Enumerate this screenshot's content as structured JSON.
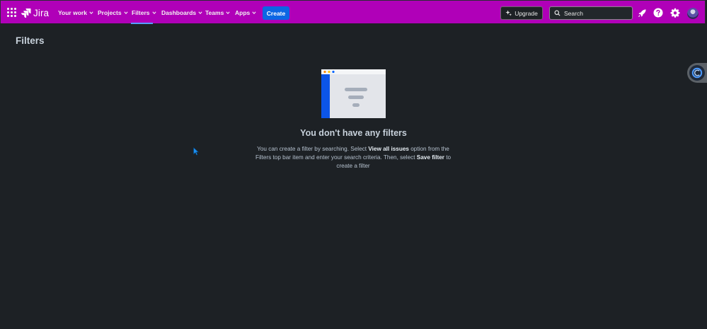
{
  "app": {
    "product_name": "Jira"
  },
  "nav": {
    "items": [
      {
        "label": "Your work"
      },
      {
        "label": "Projects"
      },
      {
        "label": "Filters"
      },
      {
        "label": "Dashboards"
      },
      {
        "label": "Teams"
      },
      {
        "label": "Apps"
      }
    ],
    "active": "Filters",
    "create_label": "Create",
    "upgrade_label": "Upgrade",
    "search_placeholder": "Search"
  },
  "page": {
    "title": "Filters"
  },
  "empty_state": {
    "heading": "You don't have any filters",
    "desc_part1": "You can create a filter by searching. Select ",
    "desc_bold1": "View all issues",
    "desc_part2": " option from the Filters top bar item and enter your search criteria. Then, select ",
    "desc_bold2": "Save filter",
    "desc_part3": " to create a filter"
  },
  "colors": {
    "nav_background": "#b000b8",
    "page_background": "#1d2125",
    "create_button": "#0c66e4",
    "active_tab_indicator": "#579dff"
  },
  "icons": {
    "apps": "app-switcher-grid-icon",
    "upgrade": "sparkle-icon",
    "search": "search-icon",
    "notifications": "notification-rocket-icon",
    "help": "help-icon",
    "settings": "gear-icon"
  }
}
